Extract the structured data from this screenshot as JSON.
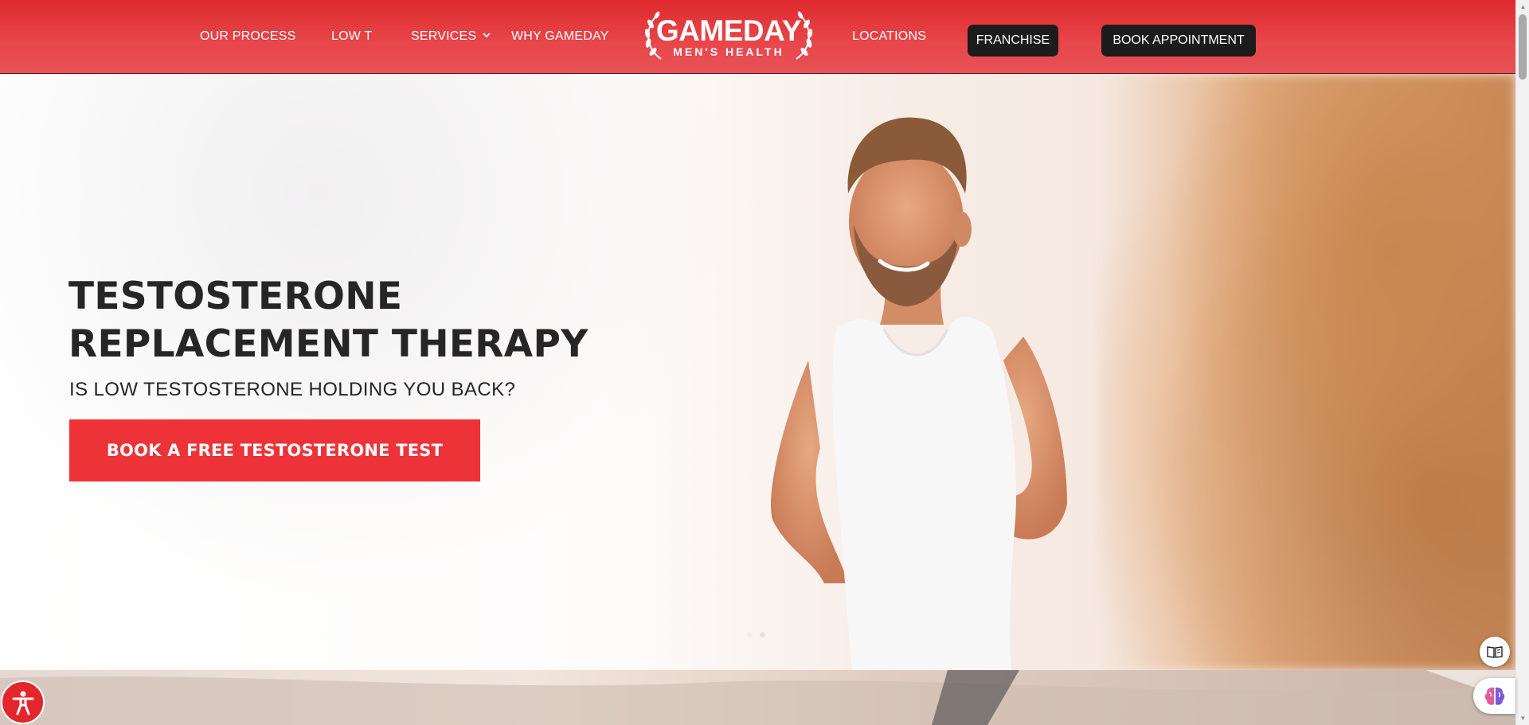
{
  "nav": {
    "links": [
      {
        "label": "OUR PROCESS"
      },
      {
        "label": "LOW T"
      },
      {
        "label": "SERVICES"
      },
      {
        "label": "WHY GAMEDAY"
      },
      {
        "label": "LOCATIONS"
      }
    ],
    "franchise_label": "FRANCHISE",
    "book_label": "BOOK APPOINTMENT"
  },
  "logo": {
    "word": "GAMEDAY",
    "sub": "MEN'S HEALTH"
  },
  "hero": {
    "title_line1": "TESTOSTERONE",
    "title_line2": "REPLACEMENT THERAPY",
    "subtitle": "IS LOW TESTOSTERONE HOLDING YOU BACK?",
    "cta_label": "BOOK A FREE TESTOSTERONE TEST",
    "slide_count": 2,
    "active_slide": 1
  },
  "colors": {
    "brand_red": "#ee3338",
    "nav_red": "#de2a2e",
    "dark_pill": "#1c1c1c",
    "text_dark": "#262626"
  },
  "icons": {
    "services_dropdown": "chevron-down-icon",
    "accessibility": "accessibility-person-icon",
    "reader": "book-reader-icon",
    "assistant": "brain-icon"
  }
}
